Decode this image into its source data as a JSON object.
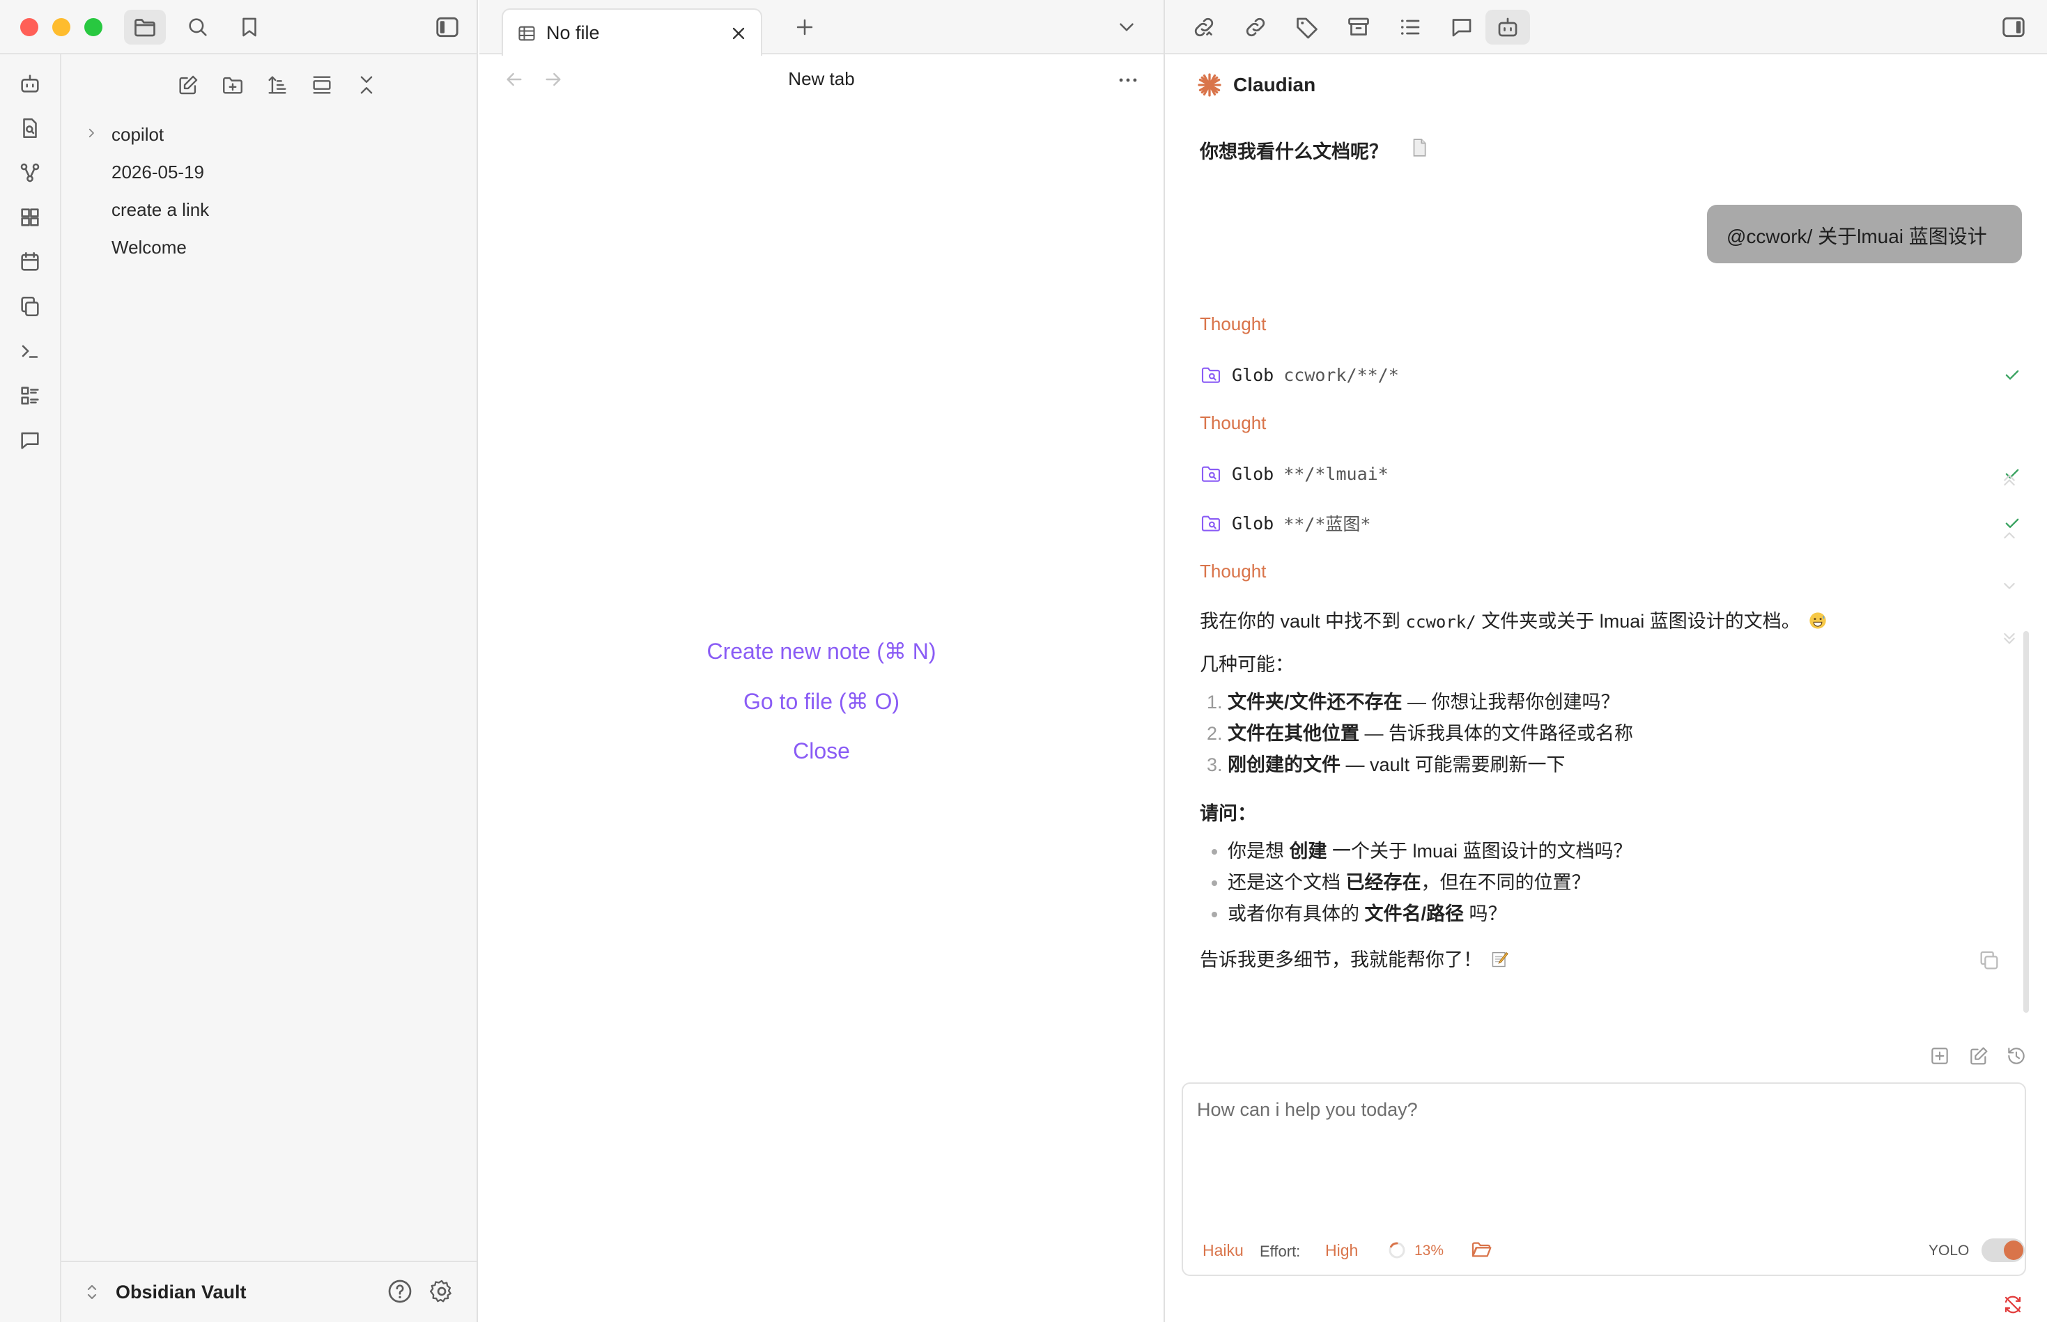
{
  "window": {
    "traffic_colors": [
      "#ff5f57",
      "#febc2e",
      "#28c840"
    ]
  },
  "toolbar_left": {
    "icons": [
      "folder-icon",
      "search-icon",
      "bookmark-icon",
      "sidebar-toggle-icon"
    ]
  },
  "ribbon": {
    "icons": [
      "bot-icon",
      "file-search-icon",
      "graph-icon",
      "blocks-icon",
      "calendar-icon",
      "copy-icon",
      "terminal-icon",
      "list-icon",
      "message-icon"
    ]
  },
  "sidebar": {
    "actions": [
      "new-note-icon",
      "new-folder-icon",
      "sort-icon",
      "collapse-view-icon",
      "collapse-all-icon"
    ],
    "tree": [
      "copilot",
      "2026-05-19",
      "create a link",
      "Welcome"
    ],
    "vault_name": "Obsidian Vault"
  },
  "center": {
    "tab_title": "No file",
    "header_title": "New tab",
    "links": {
      "create": "Create new note (⌘ N)",
      "goto": "Go to file (⌘ O)",
      "close": "Close"
    }
  },
  "right_toolbar": {
    "icons": [
      "link-icon",
      "unlink-icon",
      "tag-icon",
      "archive-icon",
      "list-icon",
      "comment-icon",
      "bot-icon",
      "sidebar-right-icon"
    ]
  },
  "chat": {
    "title": "Claudian",
    "accent": "#d9744a",
    "first_message": "你想我看什么文档呢？",
    "user_message": "@ccwork/ 关于lmuai 蓝图设计",
    "thought_label": "Thought",
    "tool_calls": [
      {
        "name": "Glob",
        "path": "ccwork/**/*"
      },
      {
        "name": "Glob",
        "path": "**/*lmuai*"
      },
      {
        "name": "Glob",
        "path": "**/*蓝图*"
      }
    ],
    "answer": {
      "p1_pre": "我在你的 vault 中找不到 ",
      "p1_code": "ccwork/",
      "p1_post": " 文件夹或关于 lmuai 蓝图设计的文档。",
      "p2": "几种可能：",
      "ol": [
        {
          "bold": "文件夹/文件还不存在",
          "rest": " — 你想让我帮你创建吗？"
        },
        {
          "bold": "文件在其他位置",
          "rest": " — 告诉我具体的文件路径或名称"
        },
        {
          "bold": "刚创建的文件",
          "rest": " — vault 可能需要刷新一下"
        }
      ],
      "ask": "请问：",
      "ul": [
        {
          "pre": "你是想 ",
          "bold": "创建",
          "post": " 一个关于 lmuai 蓝图设计的文档吗？"
        },
        {
          "pre": "还是这个文档 ",
          "bold": "已经存在",
          "post": "，但在不同的位置？"
        },
        {
          "pre": "或者你有具体的 ",
          "bold": "文件名/路径",
          "post": " 吗？"
        }
      ],
      "closing": "告诉我更多细节，我就能帮你了！"
    },
    "input_placeholder": "How can i help you today?",
    "footer": {
      "model": "Haiku",
      "effort_label": "Effort:",
      "effort_value": "High",
      "context_pct": "13%",
      "yolo_label": "YOLO"
    }
  }
}
